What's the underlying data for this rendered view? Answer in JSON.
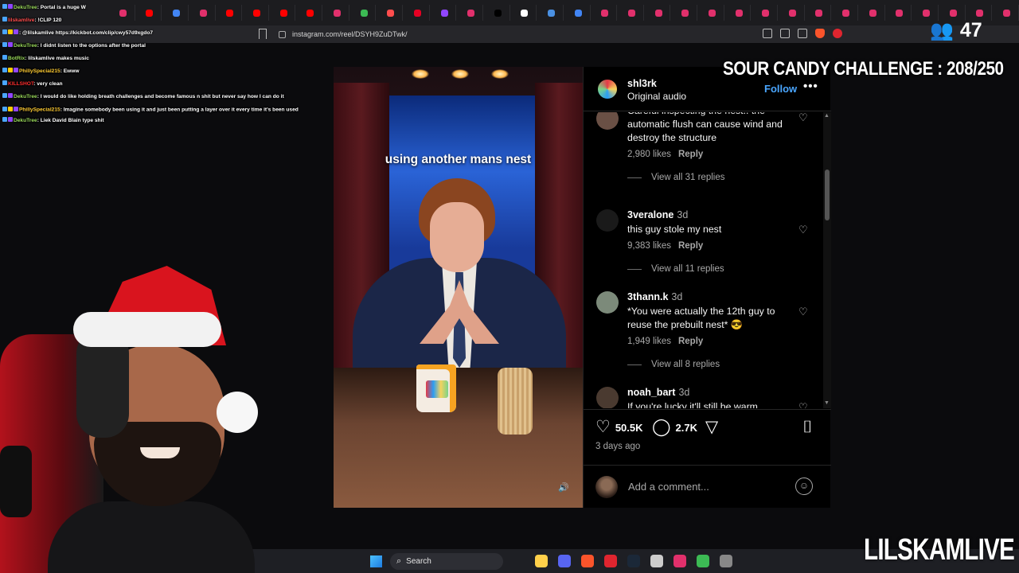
{
  "browser": {
    "url": "instagram.com/reel/DSYH9ZuDTwk/",
    "tab_favicons": [
      "#e1306c",
      "#ff0000",
      "#4285f4",
      "#e1306c",
      "#ff0000",
      "#ff0000",
      "#ff0000",
      "#ff0000",
      "#e1306c",
      "#3cba54",
      "#ff4d4d",
      "#e60023",
      "#9146ff",
      "#e1306c",
      "#000000",
      "#ffffff",
      "#4a90e2",
      "#4285f4",
      "#e1306c",
      "#e1306c",
      "#e1306c",
      "#e1306c",
      "#e1306c",
      "#e1306c",
      "#e1306c",
      "#e1306c",
      "#e1306c",
      "#e1306c",
      "#e1306c",
      "#e1306c",
      "#e1306c",
      "#e1306c",
      "#e1306c",
      "#e1306c"
    ]
  },
  "chat": [
    {
      "name": "DekuTree",
      "color": "#9ad95a",
      "text": ": Portal is a huge W",
      "badges": [
        "#4aa6ff",
        "#9146ff"
      ]
    },
    {
      "name": "lilskamlive",
      "color": "#ff4d4d",
      "text": ": !CLIP 120",
      "badges": [
        "#4aa6ff"
      ]
    },
    {
      "name": "",
      "color": "#ff2d2d",
      "text": ": @lilskamlive https://kickbot.com/clip/cwy57d9xgdo7",
      "badges": [
        "#4aa6ff",
        "#ffcc00",
        "#9146ff"
      ]
    },
    {
      "name": "DekuTree",
      "color": "#9ad95a",
      "text": ": I didnt listen to the options after the portal",
      "badges": [
        "#4aa6ff",
        "#9146ff"
      ]
    },
    {
      "name": "BotRix",
      "color": "#9ad95a",
      "text": ": lilskamlive makes music",
      "badges": [
        "#4aa6ff"
      ]
    },
    {
      "name": "PhillySpecial215",
      "color": "#ffcc33",
      "text": ": Ewww",
      "badges": [
        "#4aa6ff",
        "#ffcc00",
        "#9146ff"
      ]
    },
    {
      "name": "KILLSHOT",
      "color": "#ff2d2d",
      "text": ": very clean",
      "badges": [
        "#4aa6ff"
      ]
    },
    {
      "name": "DekuTree",
      "color": "#9ad95a",
      "text": ": I would do like holding breath challenges and become famous n shit but never say how I can do it",
      "badges": [
        "#4aa6ff",
        "#9146ff"
      ]
    },
    {
      "name": "PhillySpecial215",
      "color": "#ffcc33",
      "text": ": Imagine somebody been using it and just been putting a layer over it every time it's been used",
      "badges": [
        "#4aa6ff",
        "#ffcc00",
        "#9146ff"
      ],
      "wrap": true
    },
    {
      "name": "DekuTree",
      "color": "#9ad95a",
      "text": ": Liek David Blain type shit",
      "badges": [
        "#4aa6ff",
        "#9146ff"
      ]
    }
  ],
  "video": {
    "caption": "using another mans nest"
  },
  "post": {
    "username": "shl3rk",
    "audio": "Original audio",
    "follow_label": "Follow",
    "more_label": "•••",
    "likes": "50.5K",
    "comments_count": "2.7K",
    "posted": "3 days ago",
    "add_comment_placeholder": "Add a comment..."
  },
  "comments": [
    {
      "user": "",
      "ago": "",
      "text": "Careful inspecting the nest.. the automatic flush can cause wind and destroy the structure",
      "likes": "2,980 likes",
      "reply": "Reply",
      "view_all": "View all 31 replies",
      "avatar_color": "#6a5045"
    },
    {
      "user": "3veralone",
      "ago": "3d",
      "text": "this guy stole my nest",
      "likes": "9,383 likes",
      "reply": "Reply",
      "view_all": "View all 11 replies",
      "avatar_color": "#1a1a1a"
    },
    {
      "user": "3thann.k",
      "ago": "3d",
      "text": "*You were actually the 12th guy to reuse the prebuilt nest* 😎",
      "likes": "1,949 likes",
      "reply": "Reply",
      "view_all": "View all 8 replies",
      "avatar_color": "#7c8a7a"
    },
    {
      "user": "noah_bart",
      "ago": "3d",
      "text": "If you're lucky it'll still be warm",
      "likes": "",
      "reply": "",
      "view_all": "",
      "avatar_color": "#4a3a30"
    }
  ],
  "overlay": {
    "viewers": "47",
    "challenge": "SOUR CANDY CHALLENGE : 208/250",
    "brand": "LILSKAMLIVE"
  },
  "taskbar": {
    "search_label": "Search",
    "apps": [
      "#ffd04a",
      "#5865f2",
      "#fb542b",
      "#e0252f",
      "#1b2838",
      "#cccccc",
      "#e1306c",
      "#3cba54",
      "#888888"
    ]
  }
}
